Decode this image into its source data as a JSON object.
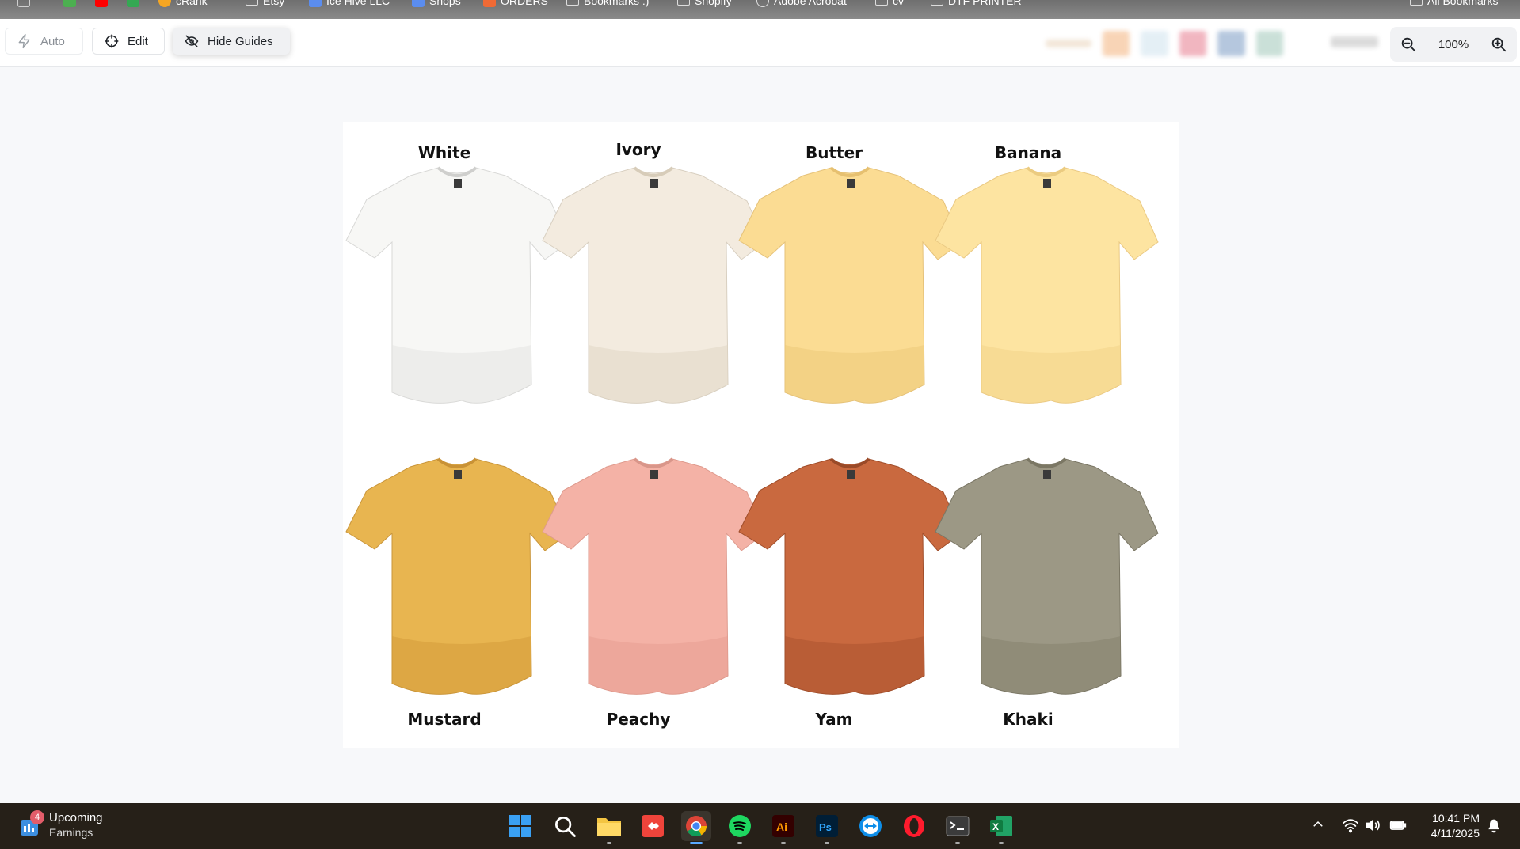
{
  "bookmarks": [
    {
      "label": "",
      "icon": "apps-grid-icon",
      "color": "#cfcfcf"
    },
    {
      "label": "",
      "icon": "multi-color-icon",
      "color": "#4caf50"
    },
    {
      "label": "",
      "icon": "youtube-icon",
      "color": "#ff0000"
    },
    {
      "label": "",
      "icon": "green-app-icon",
      "color": "#34a853"
    },
    {
      "label": "cRank",
      "icon": "crank-icon",
      "color": "#f5a623"
    },
    {
      "label": "Etsy",
      "icon": "folder-icon",
      "color": "#dddddd"
    },
    {
      "label": "Ice Hive LLC",
      "icon": "workspace-icon",
      "color": "#5b8def"
    },
    {
      "label": "Shops",
      "icon": "workspace-icon",
      "color": "#5b8def"
    },
    {
      "label": "ORDERS",
      "icon": "workspace-icon",
      "color": "#f06a35"
    },
    {
      "label": "Bookmarks :)",
      "icon": "folder-icon",
      "color": "#dddddd"
    },
    {
      "label": "Shopify",
      "icon": "folder-icon",
      "color": "#dddddd"
    },
    {
      "label": "Adobe Acrobat",
      "icon": "acrobat-icon",
      "color": "#dddddd"
    },
    {
      "label": "cv",
      "icon": "folder-icon",
      "color": "#dddddd"
    },
    {
      "label": "DTF PRINTER",
      "icon": "folder-icon",
      "color": "#dddddd"
    },
    {
      "label": "All Bookmarks",
      "icon": "folder-icon",
      "color": "#dddddd"
    }
  ],
  "toolbar": {
    "auto_label": "Auto",
    "edit_label": "Edit",
    "hide_guides_label": "Hide Guides",
    "zoom_value": "100%"
  },
  "canvas": {
    "shirts": [
      {
        "name": "White",
        "color": "#f7f7f5",
        "shade": "#e4e4e2"
      },
      {
        "name": "Ivory",
        "color": "#f3ebdf",
        "shade": "#e0d5c4"
      },
      {
        "name": "Butter",
        "color": "#fbdc93",
        "shade": "#ecc878"
      },
      {
        "name": "Banana",
        "color": "#fde4a1",
        "shade": "#f1d187"
      },
      {
        "name": "Mustard",
        "color": "#e8b550",
        "shade": "#d19a38"
      },
      {
        "name": "Peachy",
        "color": "#f4b2a6",
        "shade": "#e59c90"
      },
      {
        "name": "Yam",
        "color": "#c9693f",
        "shade": "#a9522e"
      },
      {
        "name": "Khaki",
        "color": "#9c9885",
        "shade": "#847f6c"
      }
    ]
  },
  "taskbar": {
    "widget_badge": "4",
    "widget_title": "Upcoming",
    "widget_sub": "Earnings",
    "apps": [
      {
        "icon": "windows-start-icon",
        "color": "#3aa0f3"
      },
      {
        "icon": "search-icon",
        "color": "#ffffff"
      },
      {
        "icon": "file-explorer-icon",
        "color": "#f4c542"
      },
      {
        "icon": "anydesk-icon",
        "color": "#ef443b"
      },
      {
        "icon": "chrome-icon",
        "color": "#4285f4"
      },
      {
        "icon": "spotify-icon",
        "color": "#1ed760"
      },
      {
        "icon": "illustrator-icon",
        "color": "#ff9a00"
      },
      {
        "icon": "photoshop-icon",
        "color": "#31a8ff"
      },
      {
        "icon": "teamviewer-icon",
        "color": "#0e8ee9"
      },
      {
        "icon": "opera-icon",
        "color": "#ff1b2d"
      },
      {
        "icon": "terminal-icon",
        "color": "#cccccc"
      },
      {
        "icon": "excel-icon",
        "color": "#1d6f42"
      }
    ],
    "time": "10:41 PM",
    "date": "4/11/2025"
  }
}
